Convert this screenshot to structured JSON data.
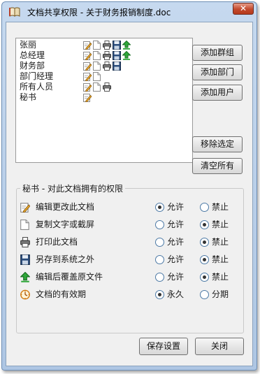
{
  "window": {
    "title": "文档共享权限 - 关于财务报销制度.doc",
    "close_label": "✕"
  },
  "users": [
    {
      "name": "张丽",
      "icons": [
        "edit-icon",
        "copy-icon",
        "print-icon",
        "save-as-icon",
        "overwrite-icon"
      ]
    },
    {
      "name": "总经理",
      "icons": [
        "edit-icon",
        "copy-icon",
        "print-icon",
        "save-as-icon",
        "overwrite-icon"
      ]
    },
    {
      "name": "财务部",
      "icons": [
        "edit-icon",
        "copy-icon",
        "print-icon",
        "save-as-icon"
      ]
    },
    {
      "name": "部门经理",
      "icons": [
        "edit-icon",
        "copy-icon"
      ]
    },
    {
      "name": "所有人员",
      "icons": [
        "edit-icon",
        "copy-icon",
        "print-icon"
      ]
    },
    {
      "name": "秘书",
      "icons": [
        "edit-icon"
      ]
    }
  ],
  "side_buttons": {
    "add_group": "添加群组",
    "add_department": "添加部门",
    "add_user": "添加用户",
    "remove_selected": "移除选定",
    "clear_all": "清空所有"
  },
  "permissions": {
    "caption": "秘书 - 对此文档拥有的权限",
    "rows": [
      {
        "icon": "edit-icon",
        "label": "编辑更改此文档",
        "option_a": "允许",
        "option_b": "禁止",
        "selected": "a"
      },
      {
        "icon": "copy-icon",
        "label": "复制文字或截屏",
        "option_a": "允许",
        "option_b": "禁止",
        "selected": "b"
      },
      {
        "icon": "print-icon",
        "label": "打印此文档",
        "option_a": "允许",
        "option_b": "禁止",
        "selected": "b"
      },
      {
        "icon": "save-as-icon",
        "label": "另存到系统之外",
        "option_a": "允许",
        "option_b": "禁止",
        "selected": "b"
      },
      {
        "icon": "overwrite-icon",
        "label": "编辑后覆盖原文件",
        "option_a": "允许",
        "option_b": "禁止",
        "selected": "b"
      },
      {
        "icon": "clock-icon",
        "label": "文档的有效期",
        "option_a": "永久",
        "option_b": "分期",
        "selected": "a"
      }
    ]
  },
  "footer": {
    "save_label": "保存设置",
    "close_label": "关闭"
  },
  "colors": {
    "window_frame": "#aec6e3",
    "close_button": "#c2492c",
    "client_bg": "#f0f0f0"
  }
}
